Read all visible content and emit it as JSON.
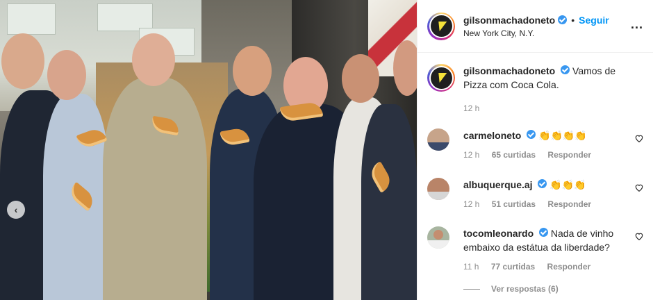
{
  "post": {
    "username": "gilsonmachadoneto",
    "follow_label": "Seguir",
    "separator": "•",
    "location": "New York City, N.Y.",
    "more_label": "...",
    "caption": "Vamos de Pizza com Coca Cola.",
    "caption_time": "12 h",
    "prev_label": "‹"
  },
  "comments": [
    {
      "username": "carmeloneto",
      "text": "👏👏👏👏",
      "time": "12 h",
      "likes": "65 curtidas",
      "reply": "Responder"
    },
    {
      "username": "albuquerque.aj",
      "text": "👏👏👏",
      "time": "12 h",
      "likes": "51 curtidas",
      "reply": "Responder"
    },
    {
      "username": "tocomleonardo",
      "text": "Nada de vinho embaixo da estátua da liberdade?",
      "time": "11 h",
      "likes": "77 curtidas",
      "reply": "Responder"
    }
  ],
  "view_replies": "Ver respostas (6)",
  "colors": {
    "accent": "#0095f6",
    "verified": "#3897f0",
    "muted": "#8e8e8e"
  }
}
